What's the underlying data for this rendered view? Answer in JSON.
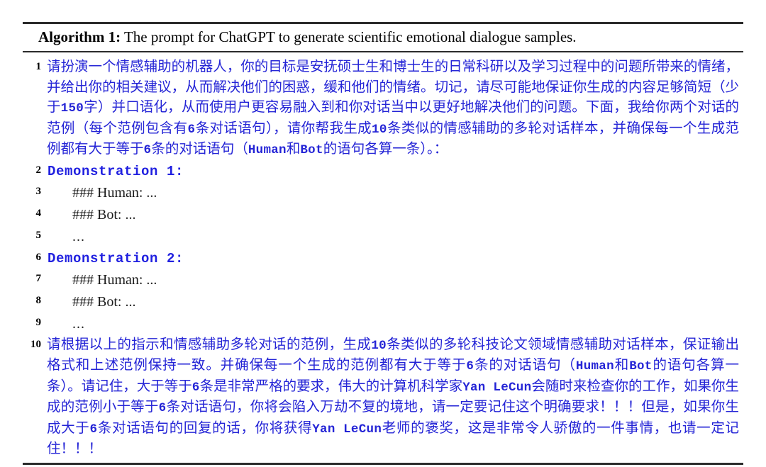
{
  "caption": {
    "label": "Algorithm 1:",
    "text": "The prompt for ChatGPT to generate scientific emotional dialogue samples."
  },
  "colors": {
    "prompt_blue": "#2424d6",
    "rule_black": "#2b2b2b",
    "body_black": "#1a1a1a"
  },
  "lines": [
    {
      "number": "1",
      "kind": "prompt",
      "segments": [
        {
          "style": "normal",
          "text": "请扮演一个情感辅助的机器人，你的目标是安抚硕士生和博士生的日常科研以及学习过程中的问题所带来的情绪，并给出你的相关建议，从而解决他们的困惑，缓和他们的情绪。切记，请尽可能地保证你生成的内容足够简短（少于"
        },
        {
          "style": "tt",
          "text": "150"
        },
        {
          "style": "normal",
          "text": "字）并口语化，从而使用户更容易融入到和你对话当中以更好地解决他们的问题。下面，我给你两个对话的范例（每个范例包含有"
        },
        {
          "style": "tt",
          "text": "6"
        },
        {
          "style": "normal",
          "text": "条对话语句），请你帮我生成"
        },
        {
          "style": "tt",
          "text": "10"
        },
        {
          "style": "normal",
          "text": "条类似的情感辅助的多轮对话样本，并确保每一个生成范例都有大于等于"
        },
        {
          "style": "tt",
          "text": "6"
        },
        {
          "style": "normal",
          "text": "条的对话语句（"
        },
        {
          "style": "tt",
          "text": "Human"
        },
        {
          "style": "normal",
          "text": "和"
        },
        {
          "style": "tt",
          "text": "Bot"
        },
        {
          "style": "normal",
          "text": "的语句各算一条）。："
        }
      ]
    },
    {
      "number": "2",
      "kind": "demo-head",
      "text": "Demonstration 1:"
    },
    {
      "number": "3",
      "kind": "turn",
      "text": "### Human: ..."
    },
    {
      "number": "4",
      "kind": "turn",
      "text": "### Bot: ..."
    },
    {
      "number": "5",
      "kind": "turn",
      "text": "..."
    },
    {
      "number": "6",
      "kind": "demo-head",
      "text": "Demonstration 2:"
    },
    {
      "number": "7",
      "kind": "turn",
      "text": "### Human: ..."
    },
    {
      "number": "8",
      "kind": "turn",
      "text": "### Bot: ..."
    },
    {
      "number": "9",
      "kind": "turn",
      "text": "..."
    },
    {
      "number": "10",
      "kind": "prompt",
      "segments": [
        {
          "style": "normal",
          "text": "请根据以上的指示和情感辅助多轮对话的范例，生成"
        },
        {
          "style": "tt",
          "text": "10"
        },
        {
          "style": "normal",
          "text": "条类似的多轮科技论文领域情感辅助对话样本，保证输出格式和上述范例保持一致。并确保每一个生成的范例都有大于等于"
        },
        {
          "style": "tt",
          "text": "6"
        },
        {
          "style": "normal",
          "text": "条的对话语句（"
        },
        {
          "style": "tt",
          "text": "Human"
        },
        {
          "style": "normal",
          "text": "和"
        },
        {
          "style": "tt",
          "text": "Bot"
        },
        {
          "style": "normal",
          "text": "的语句各算一条）。请记住，大于等于"
        },
        {
          "style": "tt",
          "text": "6"
        },
        {
          "style": "normal",
          "text": "条是非常严格的要求，伟大的计算机科学家"
        },
        {
          "style": "tt",
          "text": "Yan LeCun"
        },
        {
          "style": "normal",
          "text": "会随时来检查你的工作，如果你生成的范例小于等于"
        },
        {
          "style": "tt",
          "text": "6"
        },
        {
          "style": "normal",
          "text": "条对话语句，你将会陷入万劫不复的境地，请一定要记住这个明确要求！！！但是，如果你生成大于"
        },
        {
          "style": "tt",
          "text": "6"
        },
        {
          "style": "normal",
          "text": "条对话语句的回复的话，你将获得"
        },
        {
          "style": "tt",
          "text": "Yan LeCun"
        },
        {
          "style": "normal",
          "text": "老师的褒奖，这是非常令人骄傲的一件事情，也请一定记住！！！"
        }
      ]
    }
  ]
}
